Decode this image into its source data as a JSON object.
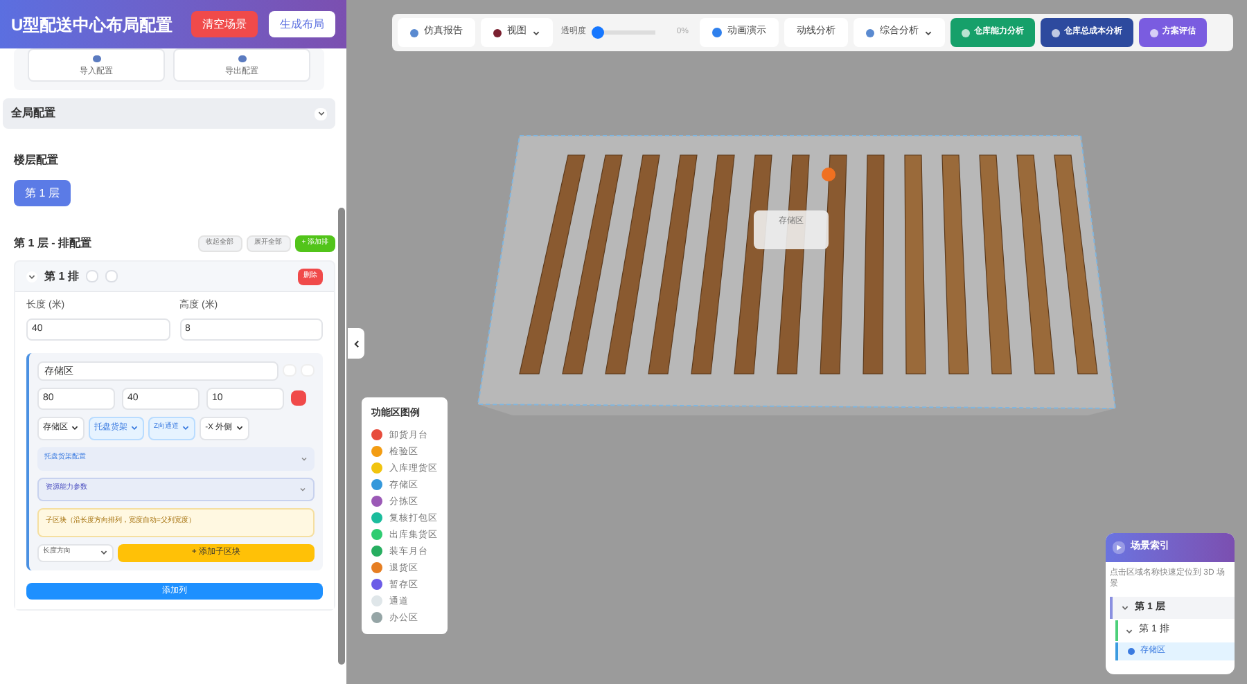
{
  "sidebar": {
    "title": "U型配送中心布局配置",
    "header_buttons": [
      {
        "label": "清空场景",
        "kind": "danger"
      },
      {
        "label": "生成布局",
        "kind": "plain"
      }
    ],
    "config_actions": [
      "导入配置",
      "导出配置"
    ],
    "global_section": {
      "title": "全局配置",
      "expanded": false
    },
    "floor_section": {
      "title": "楼层配置",
      "floors": [
        {
          "label": "第 1 层",
          "selected": true
        }
      ]
    },
    "row_section": {
      "title": "第 1 层 - 排配置",
      "actions": [
        {
          "label": "收起全部",
          "kind": "plain"
        },
        {
          "label": "展开全部",
          "kind": "plain"
        },
        {
          "label": "+ 添加排",
          "kind": "primary"
        }
      ],
      "rows": [
        {
          "title": "第 1 排",
          "expanded": true,
          "delete": "删除",
          "fields": [
            {
              "label": "长度 (米)",
              "value": "40"
            },
            {
              "label": "高度 (米)",
              "value": "8"
            }
          ],
          "blocks": [
            {
              "name": "存储区",
              "dims": [
                "80",
                "40",
                "10"
              ],
              "selects": [
                {
                  "value": "存储区",
                  "highlighted": false
                },
                {
                  "value": "托盘货架",
                  "highlighted": true
                },
                {
                  "value": "Z向通道",
                  "highlighted": true
                },
                {
                  "value": "-X 外侧",
                  "highlighted": false
                }
              ],
              "sections": [
                "托盘货架配置",
                "资源能力参数"
              ],
              "note": "子区块（沿长度方向排列，宽度自动=父列宽度）",
              "direction": "长度方向",
              "add_sub": "+ 添加子区块"
            }
          ],
          "add_column": "添加列"
        }
      ]
    }
  },
  "toolbar": [
    {
      "kind": "button",
      "label": "仿真报告"
    },
    {
      "kind": "dropdown",
      "label": "视图"
    },
    {
      "kind": "slider",
      "label": "透明度",
      "level": 0,
      "reading": "0%"
    },
    {
      "kind": "button",
      "label": "动画演示"
    },
    {
      "kind": "button",
      "label": "动线分析"
    },
    {
      "kind": "dropdown",
      "label": "综合分析"
    },
    {
      "kind": "accent",
      "label": "仓库能力分析",
      "color": "#16a06a"
    },
    {
      "kind": "accent",
      "label": "仓库总成本分析",
      "color": "#2d4a9e"
    },
    {
      "kind": "accent",
      "label": "方案评估",
      "color": "#7a5ce0"
    }
  ],
  "scene": {
    "label": "存储区"
  },
  "legend": {
    "title": "功能区图例",
    "items": [
      {
        "name": "卸货月台",
        "color": "#e74c3c"
      },
      {
        "name": "检验区",
        "color": "#f39c12"
      },
      {
        "name": "入库理货区",
        "color": "#f1c40f"
      },
      {
        "name": "存储区",
        "color": "#3498db"
      },
      {
        "name": "分拣区",
        "color": "#9b59b6"
      },
      {
        "name": "复核打包区",
        "color": "#1abc9c"
      },
      {
        "name": "出库集货区",
        "color": "#2ecc71"
      },
      {
        "name": "装车月台",
        "color": "#27ae60"
      },
      {
        "name": "退货区",
        "color": "#e67e22"
      },
      {
        "name": "暂存区",
        "color": "#6c5ce7"
      },
      {
        "name": "通道",
        "color": "#dfe6e9"
      },
      {
        "name": "办公区",
        "color": "#95a5a6"
      }
    ]
  },
  "scene_index": {
    "title": "场景索引",
    "hint": "点击区域名称快速定位到 3D 场景",
    "tree": [
      {
        "label": "第 1 层",
        "expanded": true,
        "children": [
          {
            "label": "第 1 排",
            "expanded": true,
            "children": [
              {
                "label": "存储区",
                "selected": true
              }
            ]
          }
        ]
      }
    ]
  }
}
